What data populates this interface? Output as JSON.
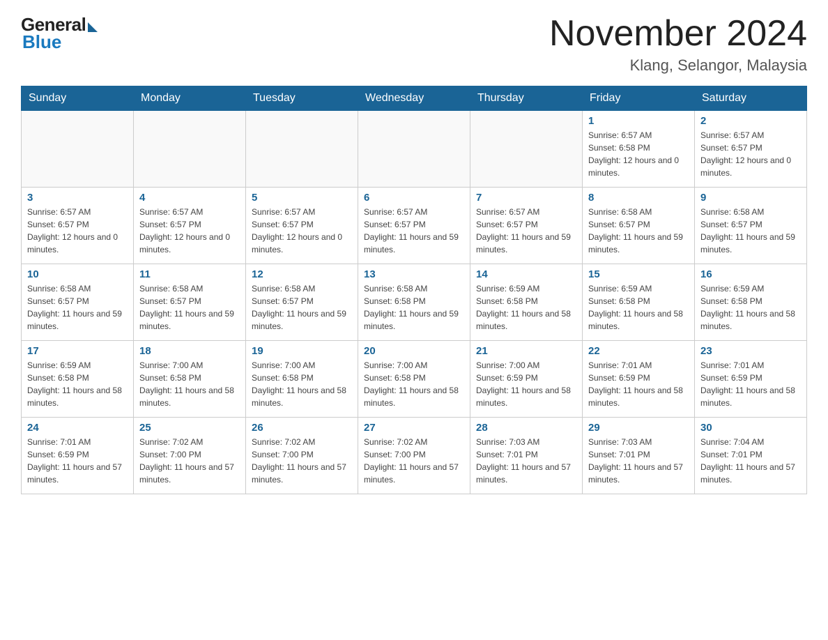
{
  "header": {
    "logo_general": "General",
    "logo_blue": "Blue",
    "month_title": "November 2024",
    "location": "Klang, Selangor, Malaysia"
  },
  "days_of_week": [
    "Sunday",
    "Monday",
    "Tuesday",
    "Wednesday",
    "Thursday",
    "Friday",
    "Saturday"
  ],
  "weeks": [
    [
      {
        "day": "",
        "info": ""
      },
      {
        "day": "",
        "info": ""
      },
      {
        "day": "",
        "info": ""
      },
      {
        "day": "",
        "info": ""
      },
      {
        "day": "",
        "info": ""
      },
      {
        "day": "1",
        "info": "Sunrise: 6:57 AM\nSunset: 6:58 PM\nDaylight: 12 hours and 0 minutes."
      },
      {
        "day": "2",
        "info": "Sunrise: 6:57 AM\nSunset: 6:57 PM\nDaylight: 12 hours and 0 minutes."
      }
    ],
    [
      {
        "day": "3",
        "info": "Sunrise: 6:57 AM\nSunset: 6:57 PM\nDaylight: 12 hours and 0 minutes."
      },
      {
        "day": "4",
        "info": "Sunrise: 6:57 AM\nSunset: 6:57 PM\nDaylight: 12 hours and 0 minutes."
      },
      {
        "day": "5",
        "info": "Sunrise: 6:57 AM\nSunset: 6:57 PM\nDaylight: 12 hours and 0 minutes."
      },
      {
        "day": "6",
        "info": "Sunrise: 6:57 AM\nSunset: 6:57 PM\nDaylight: 11 hours and 59 minutes."
      },
      {
        "day": "7",
        "info": "Sunrise: 6:57 AM\nSunset: 6:57 PM\nDaylight: 11 hours and 59 minutes."
      },
      {
        "day": "8",
        "info": "Sunrise: 6:58 AM\nSunset: 6:57 PM\nDaylight: 11 hours and 59 minutes."
      },
      {
        "day": "9",
        "info": "Sunrise: 6:58 AM\nSunset: 6:57 PM\nDaylight: 11 hours and 59 minutes."
      }
    ],
    [
      {
        "day": "10",
        "info": "Sunrise: 6:58 AM\nSunset: 6:57 PM\nDaylight: 11 hours and 59 minutes."
      },
      {
        "day": "11",
        "info": "Sunrise: 6:58 AM\nSunset: 6:57 PM\nDaylight: 11 hours and 59 minutes."
      },
      {
        "day": "12",
        "info": "Sunrise: 6:58 AM\nSunset: 6:57 PM\nDaylight: 11 hours and 59 minutes."
      },
      {
        "day": "13",
        "info": "Sunrise: 6:58 AM\nSunset: 6:58 PM\nDaylight: 11 hours and 59 minutes."
      },
      {
        "day": "14",
        "info": "Sunrise: 6:59 AM\nSunset: 6:58 PM\nDaylight: 11 hours and 58 minutes."
      },
      {
        "day": "15",
        "info": "Sunrise: 6:59 AM\nSunset: 6:58 PM\nDaylight: 11 hours and 58 minutes."
      },
      {
        "day": "16",
        "info": "Sunrise: 6:59 AM\nSunset: 6:58 PM\nDaylight: 11 hours and 58 minutes."
      }
    ],
    [
      {
        "day": "17",
        "info": "Sunrise: 6:59 AM\nSunset: 6:58 PM\nDaylight: 11 hours and 58 minutes."
      },
      {
        "day": "18",
        "info": "Sunrise: 7:00 AM\nSunset: 6:58 PM\nDaylight: 11 hours and 58 minutes."
      },
      {
        "day": "19",
        "info": "Sunrise: 7:00 AM\nSunset: 6:58 PM\nDaylight: 11 hours and 58 minutes."
      },
      {
        "day": "20",
        "info": "Sunrise: 7:00 AM\nSunset: 6:58 PM\nDaylight: 11 hours and 58 minutes."
      },
      {
        "day": "21",
        "info": "Sunrise: 7:00 AM\nSunset: 6:59 PM\nDaylight: 11 hours and 58 minutes."
      },
      {
        "day": "22",
        "info": "Sunrise: 7:01 AM\nSunset: 6:59 PM\nDaylight: 11 hours and 58 minutes."
      },
      {
        "day": "23",
        "info": "Sunrise: 7:01 AM\nSunset: 6:59 PM\nDaylight: 11 hours and 58 minutes."
      }
    ],
    [
      {
        "day": "24",
        "info": "Sunrise: 7:01 AM\nSunset: 6:59 PM\nDaylight: 11 hours and 57 minutes."
      },
      {
        "day": "25",
        "info": "Sunrise: 7:02 AM\nSunset: 7:00 PM\nDaylight: 11 hours and 57 minutes."
      },
      {
        "day": "26",
        "info": "Sunrise: 7:02 AM\nSunset: 7:00 PM\nDaylight: 11 hours and 57 minutes."
      },
      {
        "day": "27",
        "info": "Sunrise: 7:02 AM\nSunset: 7:00 PM\nDaylight: 11 hours and 57 minutes."
      },
      {
        "day": "28",
        "info": "Sunrise: 7:03 AM\nSunset: 7:01 PM\nDaylight: 11 hours and 57 minutes."
      },
      {
        "day": "29",
        "info": "Sunrise: 7:03 AM\nSunset: 7:01 PM\nDaylight: 11 hours and 57 minutes."
      },
      {
        "day": "30",
        "info": "Sunrise: 7:04 AM\nSunset: 7:01 PM\nDaylight: 11 hours and 57 minutes."
      }
    ]
  ]
}
